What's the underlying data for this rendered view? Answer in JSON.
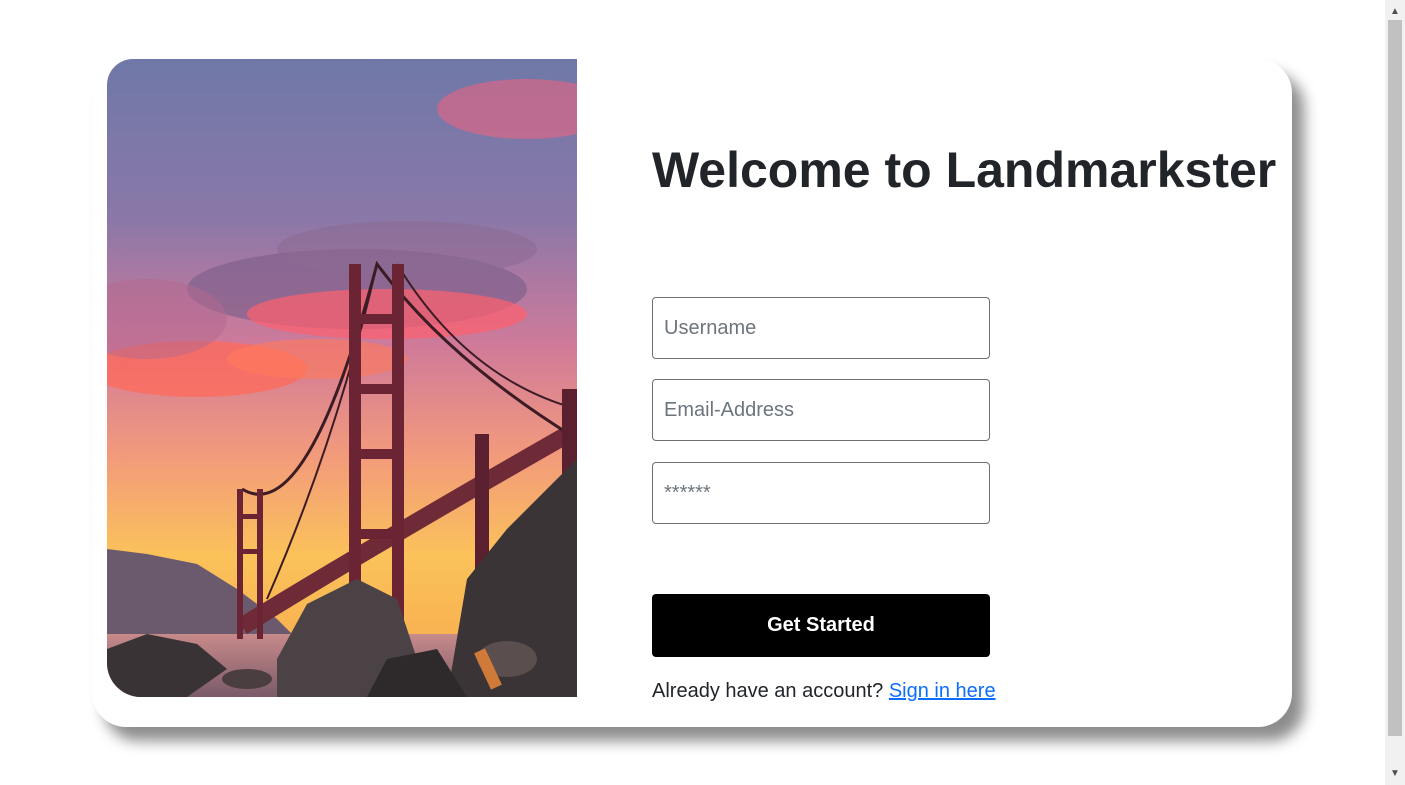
{
  "page": {
    "title": "Welcome to Landmarkster"
  },
  "hero": {
    "image": "golden-gate-bridge-sunset"
  },
  "form": {
    "username_placeholder": "Username",
    "email_placeholder": "Email-Address",
    "password_placeholder": "******",
    "submit_label": "Get Started"
  },
  "signin": {
    "prompt": "Already have an account?",
    "link_label": "Sign in here"
  },
  "colors": {
    "button_bg": "#000000",
    "link": "#0d6efd",
    "text": "#212529"
  },
  "icons": {
    "scroll_up": "▲",
    "scroll_down": "▼"
  }
}
